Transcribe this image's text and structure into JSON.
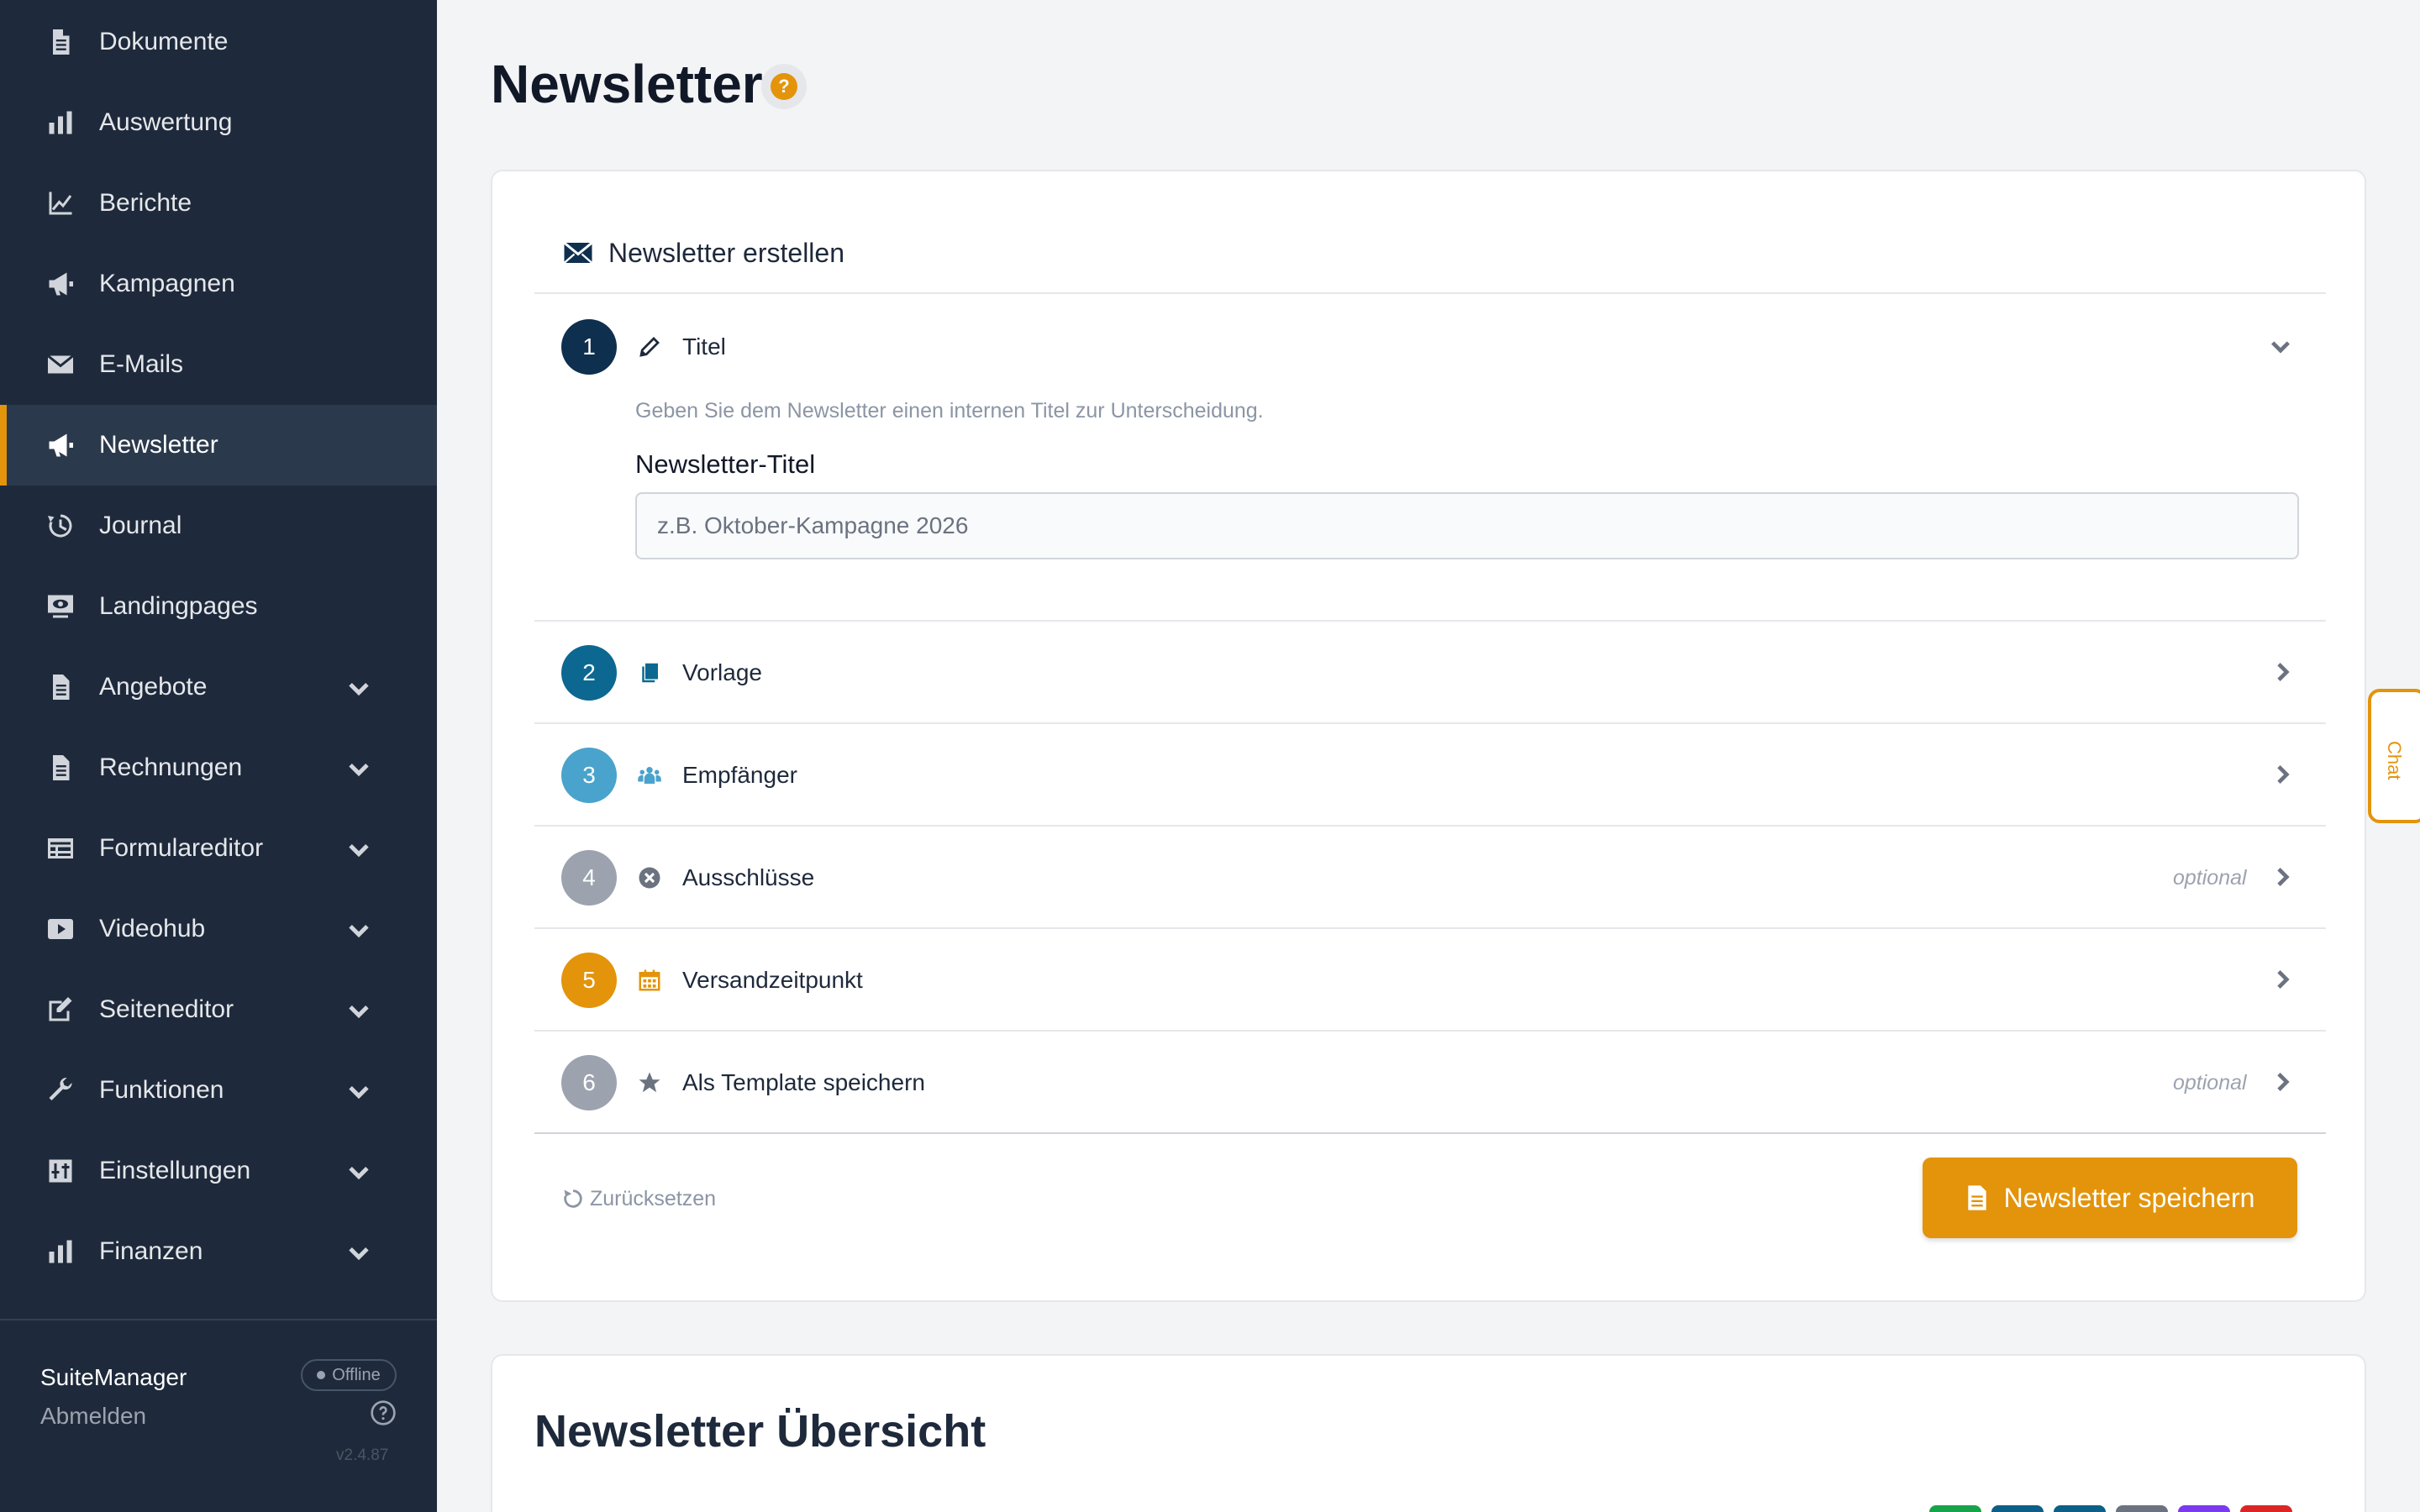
{
  "sidebar": {
    "items": [
      {
        "label": "Dokumente",
        "icon": "document-icon",
        "expandable": false
      },
      {
        "label": "Auswertung",
        "icon": "bar-chart-icon",
        "expandable": false
      },
      {
        "label": "Berichte",
        "icon": "line-chart-icon",
        "expandable": false
      },
      {
        "label": "Kampagnen",
        "icon": "megaphone-icon",
        "expandable": false
      },
      {
        "label": "E-Mails",
        "icon": "envelope-icon",
        "expandable": false
      },
      {
        "label": "Newsletter",
        "icon": "megaphone-icon",
        "expandable": false,
        "active": true
      },
      {
        "label": "Journal",
        "icon": "history-icon",
        "expandable": false
      },
      {
        "label": "Landingpages",
        "icon": "monitor-eye-icon",
        "expandable": false
      },
      {
        "label": "Angebote",
        "icon": "document-icon",
        "expandable": true
      },
      {
        "label": "Rechnungen",
        "icon": "document-icon",
        "expandable": true
      },
      {
        "label": "Formulareditor",
        "icon": "form-icon",
        "expandable": true
      },
      {
        "label": "Videohub",
        "icon": "play-icon",
        "expandable": true
      },
      {
        "label": "Seiteneditor",
        "icon": "edit-page-icon",
        "expandable": true
      },
      {
        "label": "Funktionen",
        "icon": "wrench-icon",
        "expandable": true
      },
      {
        "label": "Einstellungen",
        "icon": "sliders-icon",
        "expandable": true
      },
      {
        "label": "Finanzen",
        "icon": "bar-chart-icon",
        "expandable": true
      }
    ],
    "user": "SuiteManager",
    "status": "Offline",
    "logout": "Abmelden",
    "version": "v2.4.87"
  },
  "page": {
    "title": "Newsletter"
  },
  "editor": {
    "title": "Newsletter erstellen",
    "steps": [
      {
        "number": "1",
        "label": "Titel",
        "icon": "pencil-icon",
        "color": "#0f2f4f",
        "optional": "",
        "expanded": true
      },
      {
        "number": "2",
        "label": "Vorlage",
        "icon": "copy-icon",
        "color": "#0c6890",
        "optional": ""
      },
      {
        "number": "3",
        "label": "Empfänger",
        "icon": "users-icon",
        "color": "#4aa3cc",
        "optional": ""
      },
      {
        "number": "4",
        "label": "Ausschlüsse",
        "icon": "circle-x-icon",
        "color": "#9ca3af",
        "optional": "optional"
      },
      {
        "number": "5",
        "label": "Versandzeitpunkt",
        "icon": "calendar-icon",
        "color": "#e3940b",
        "optional": ""
      },
      {
        "number": "6",
        "label": "Als Template speichern",
        "icon": "star-icon",
        "color": "#9ca3af",
        "optional": "optional"
      }
    ],
    "hint": "Geben Sie dem Newsletter einen internen Titel zur Unterscheidung.",
    "field_label": "Newsletter-Titel",
    "field_placeholder": "z.B. Oktober-Kampagne 2026",
    "field_value": "",
    "reset_label": "Zurücksetzen",
    "save_label": "Newsletter speichern"
  },
  "overview": {
    "title": "Newsletter Übersicht"
  },
  "chat": {
    "label": "Chat"
  },
  "colors": {
    "accent": "#e3940b",
    "sidebar": "#1e2a3b",
    "sidebar_active": "#2b394c"
  }
}
